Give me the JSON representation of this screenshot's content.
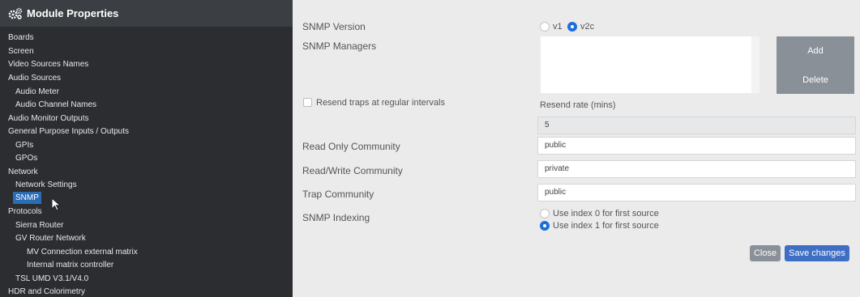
{
  "sidebar": {
    "title": "Module Properties",
    "items": [
      {
        "label": "Boards"
      },
      {
        "label": "Screen"
      },
      {
        "label": "Video Sources Names"
      },
      {
        "label": "Audio Sources"
      },
      {
        "label": "Audio Meter"
      },
      {
        "label": "Audio Channel Names"
      },
      {
        "label": "Audio Monitor Outputs"
      },
      {
        "label": "General Purpose Inputs / Outputs"
      },
      {
        "label": "GPIs"
      },
      {
        "label": "GPOs"
      },
      {
        "label": "Network"
      },
      {
        "label": "Network Settings"
      },
      {
        "label": "SNMP"
      },
      {
        "label": "Protocols"
      },
      {
        "label": "Sierra Router"
      },
      {
        "label": "GV Router Network"
      },
      {
        "label": "MV Connection external matrix"
      },
      {
        "label": "Internal matrix controller"
      },
      {
        "label": "TSL UMD V3.1/V4.0"
      },
      {
        "label": "HDR and Colorimetry"
      }
    ],
    "active_item": "SNMP"
  },
  "form": {
    "snmp_version": {
      "label": "SNMP Version",
      "options": [
        "v1",
        "v2c"
      ],
      "selected": "v2c"
    },
    "snmp_managers": {
      "label": "SNMP Managers",
      "add_label": "Add",
      "delete_label": "Delete"
    },
    "resend": {
      "checkbox_label": "Resend traps at regular intervals",
      "checked": false,
      "rate_label": "Resend rate (mins)",
      "rate_value": "5"
    },
    "read_only_community": {
      "label": "Read Only Community",
      "value": "public"
    },
    "read_write_community": {
      "label": "Read/Write Community",
      "value": "private"
    },
    "trap_community": {
      "label": "Trap Community",
      "value": "public"
    },
    "snmp_indexing": {
      "label": "SNMP Indexing",
      "options": [
        "Use index 0 for first source",
        "Use index 1 for first source"
      ],
      "selected": "Use index 1 for first source"
    }
  },
  "footer": {
    "close_label": "Close",
    "save_label": "Save changes"
  },
  "colors": {
    "sidebar_bg": "#2b2d30",
    "sidebar_header_bg": "#3b3e42",
    "active_item_bg": "#2a6db5",
    "panel_bg": "#ebebeb",
    "radio_selected": "#1e6fd9",
    "save_button": "#3f6fc4",
    "close_button": "#8a9097"
  }
}
